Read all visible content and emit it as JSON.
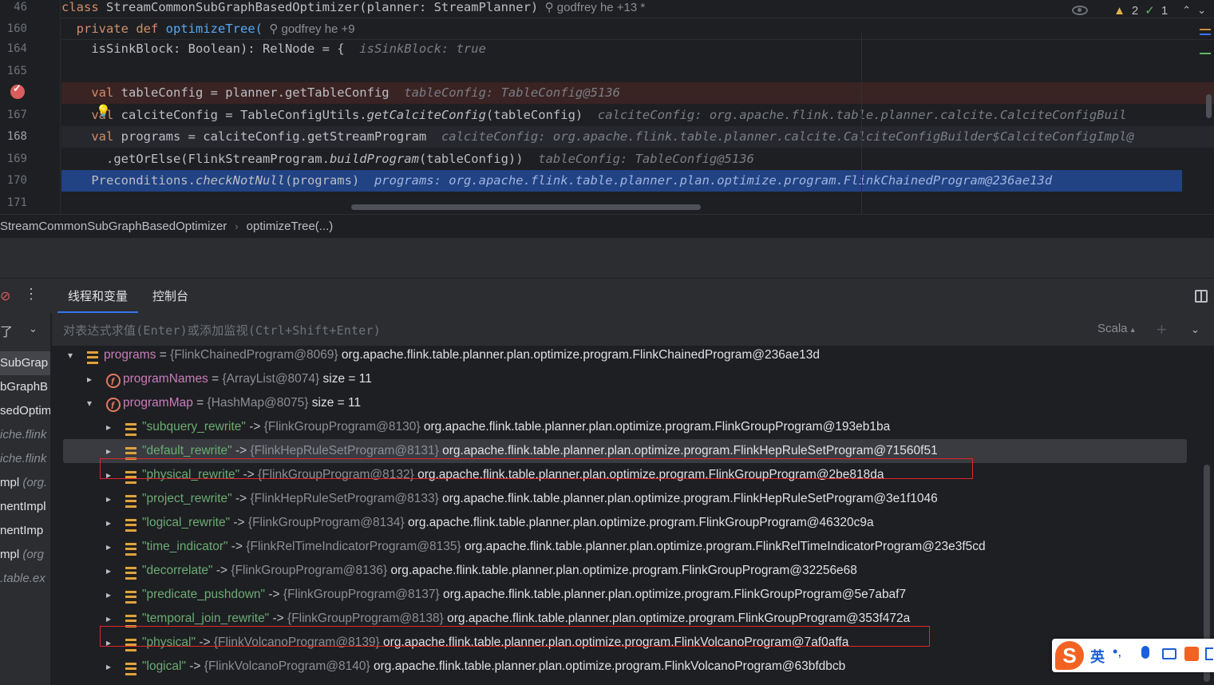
{
  "editor": {
    "gutter_lines": [
      "46",
      "160",
      "164",
      "165",
      "",
      "167",
      "168",
      "169",
      "170",
      "171"
    ],
    "sticky": [
      {
        "kw": "class",
        "rest": " StreamCommonSubGraphBasedOptimizer(planner: StreamPlanner)",
        "author": "godfrey he +13 *"
      },
      {
        "kw": "private def",
        "fn": "optimizeTree(",
        "author": "godfrey he +9"
      }
    ],
    "lines": {
      "l164_code": "    isSinkBlock: Boolean): RelNode = {",
      "l164_hint": "isSinkBlock: true",
      "l166_kw": "val",
      "l166_code": " tableConfig = planner.getTableConfig",
      "l166_hint": "tableConfig: TableConfig@5136",
      "l167_kw": "val",
      "l167_code1": " calciteConfig = TableConfigUtils.",
      "l167_italic": "getCalciteConfig",
      "l167_code2": "(tableConfig)",
      "l167_hint": "calciteConfig: org.apache.flink.table.planner.calcite.CalciteConfigBuil",
      "l168_kw": "val",
      "l168_code": " programs = calciteConfig.getStreamProgram",
      "l168_hint": "calciteConfig: org.apache.flink.table.planner.calcite.CalciteConfigBuilder$CalciteConfigImpl@",
      "l169_code1": "      .getOrElse(FlinkStreamProgram.",
      "l169_italic": "buildProgram",
      "l169_code2": "(tableConfig))",
      "l169_hint": "tableConfig: TableConfig@5136",
      "l170_code1": "Preconditions.",
      "l170_italic": "checkNotNull",
      "l170_code2": "(programs)",
      "l170_hint": "programs: org.apache.flink.table.planner.plan.optimize.program.FlinkChainedProgram@236ae13d"
    },
    "inspections": {
      "warnings": "2",
      "ok": "1"
    }
  },
  "breadcrumb": {
    "class_name": "StreamCommonSubGraphBasedOptimizer",
    "method": "optimizeTree(...)"
  },
  "debug": {
    "tabs": [
      "线程和变量",
      "控制台"
    ],
    "eval_placeholder": "对表达式求值(Enter)或添加监视(Ctrl+Shift+Enter)",
    "language": "Scala",
    "frames": [
      {
        "text": "SubGrap",
        "dim": false
      },
      {
        "text": "bGraphB",
        "dim": false
      },
      {
        "text": "sedOptim",
        "dim": false
      },
      {
        "text": "iche.flink",
        "dim": true
      },
      {
        "text": "iche.flink",
        "dim": true
      },
      {
        "text": "mpl ",
        "dim_suffix": "(org.",
        "dim": false
      },
      {
        "text": "nentImpl",
        "dim": false
      },
      {
        "text": "nentImp",
        "dim": false
      },
      {
        "text": "mpl ",
        "dim_suffix": "(org",
        "dim": false
      },
      {
        "text": ".table.ex",
        "dim": true
      }
    ],
    "frame_dropdown": "了",
    "variables": [
      {
        "level": 0,
        "arrow": "▾",
        "icon": "stack",
        "name": "programs",
        "type": "{FlinkChainedProgram@8069}",
        "value": "org.apache.flink.table.planner.plan.optimize.program.FlinkChainedProgram@236ae13d"
      },
      {
        "level": 1,
        "arrow": "▸",
        "icon": "field",
        "name": "programNames",
        "type": "{ArrayList@8074}",
        "value": "size = 11"
      },
      {
        "level": 1,
        "arrow": "▾",
        "icon": "field",
        "name": "programMap",
        "type": "{HashMap@8075}",
        "value": "size = 11"
      },
      {
        "level": 2,
        "arrow": "▸",
        "icon": "stack",
        "key": "\"subquery_rewrite\"",
        "type": "{FlinkGroupProgram@8130}",
        "value": "org.apache.flink.table.planner.plan.optimize.program.FlinkGroupProgram@193eb1ba"
      },
      {
        "level": 2,
        "arrow": "▸",
        "icon": "stack",
        "key": "\"default_rewrite\"",
        "type": "{FlinkHepRuleSetProgram@8131}",
        "value": "org.apache.flink.table.planner.plan.optimize.program.FlinkHepRuleSetProgram@71560f51",
        "highlight": true
      },
      {
        "level": 2,
        "arrow": "▸",
        "icon": "stack",
        "key": "\"physical_rewrite\"",
        "type": "{FlinkGroupProgram@8132}",
        "value": "org.apache.flink.table.planner.plan.optimize.program.FlinkGroupProgram@2be818da",
        "boxed": true
      },
      {
        "level": 2,
        "arrow": "▸",
        "icon": "stack",
        "key": "\"project_rewrite\"",
        "type": "{FlinkHepRuleSetProgram@8133}",
        "value": "org.apache.flink.table.planner.plan.optimize.program.FlinkHepRuleSetProgram@3e1f1046"
      },
      {
        "level": 2,
        "arrow": "▸",
        "icon": "stack",
        "key": "\"logical_rewrite\"",
        "type": "{FlinkGroupProgram@8134}",
        "value": "org.apache.flink.table.planner.plan.optimize.program.FlinkGroupProgram@46320c9a"
      },
      {
        "level": 2,
        "arrow": "▸",
        "icon": "stack",
        "key": "\"time_indicator\"",
        "type": "{FlinkRelTimeIndicatorProgram@8135}",
        "value": "org.apache.flink.table.planner.plan.optimize.program.FlinkRelTimeIndicatorProgram@23e3f5cd"
      },
      {
        "level": 2,
        "arrow": "▸",
        "icon": "stack",
        "key": "\"decorrelate\"",
        "type": "{FlinkGroupProgram@8136}",
        "value": "org.apache.flink.table.planner.plan.optimize.program.FlinkGroupProgram@32256e68"
      },
      {
        "level": 2,
        "arrow": "▸",
        "icon": "stack",
        "key": "\"predicate_pushdown\"",
        "type": "{FlinkGroupProgram@8137}",
        "value": "org.apache.flink.table.planner.plan.optimize.program.FlinkGroupProgram@5e7abaf7"
      },
      {
        "level": 2,
        "arrow": "▸",
        "icon": "stack",
        "key": "\"temporal_join_rewrite\"",
        "type": "{FlinkGroupProgram@8138}",
        "value": "org.apache.flink.table.planner.plan.optimize.program.FlinkGroupProgram@353f472a"
      },
      {
        "level": 2,
        "arrow": "▸",
        "icon": "stack",
        "key": "\"physical\"",
        "type": "{FlinkVolcanoProgram@8139}",
        "value": "org.apache.flink.table.planner.plan.optimize.program.FlinkVolcanoProgram@7af0affa",
        "boxed": true
      },
      {
        "level": 2,
        "arrow": "▸",
        "icon": "stack",
        "key": "\"logical\"",
        "type": "{FlinkVolcanoProgram@8140}",
        "value": "org.apache.flink.table.planner.plan.optimize.program.FlinkVolcanoProgram@63bfdbcb"
      }
    ]
  },
  "ime": {
    "logo": "S",
    "lang": "英",
    "punct": "•,"
  },
  "colors": {
    "accent": "#3574f0",
    "selection": "#214283",
    "breakpoint": "#db5c5c",
    "annotation_box": "#e0262b"
  }
}
